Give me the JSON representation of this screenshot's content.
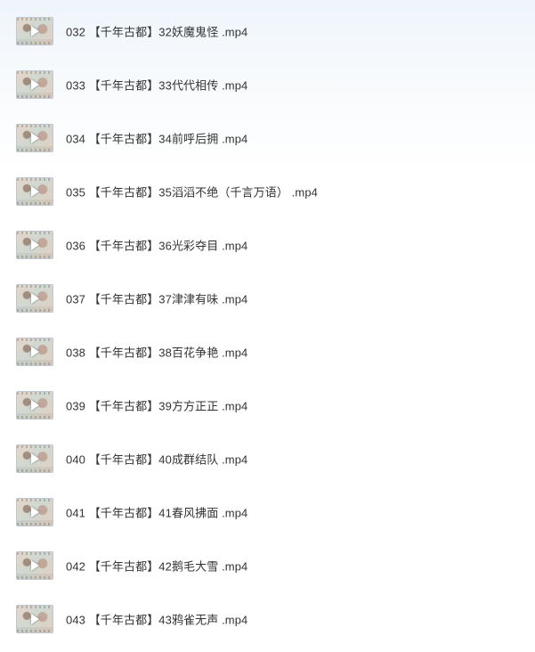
{
  "files": [
    {
      "name": "032 【千年古都】32妖魔鬼怪 .mp4",
      "icon": "video-thumbnail-icon"
    },
    {
      "name": "033 【千年古都】33代代相传 .mp4",
      "icon": "video-thumbnail-icon"
    },
    {
      "name": "034 【千年古都】34前呼后拥 .mp4",
      "icon": "video-thumbnail-icon"
    },
    {
      "name": "035 【千年古都】35滔滔不绝（千言万语） .mp4",
      "icon": "video-thumbnail-icon"
    },
    {
      "name": "036 【千年古都】36光彩夺目 .mp4",
      "icon": "video-thumbnail-icon"
    },
    {
      "name": "037 【千年古都】37津津有味 .mp4",
      "icon": "video-thumbnail-icon"
    },
    {
      "name": "038 【千年古都】38百花争艳 .mp4",
      "icon": "video-thumbnail-icon"
    },
    {
      "name": "039 【千年古都】39方方正正 .mp4",
      "icon": "video-thumbnail-icon"
    },
    {
      "name": "040 【千年古都】40成群结队 .mp4",
      "icon": "video-thumbnail-icon"
    },
    {
      "name": "041 【千年古都】41春风拂面 .mp4",
      "icon": "video-thumbnail-icon"
    },
    {
      "name": "042 【千年古都】42鹅毛大雪 .mp4",
      "icon": "video-thumbnail-icon"
    },
    {
      "name": "043 【千年古都】43鸦雀无声 .mp4",
      "icon": "video-thumbnail-icon"
    }
  ]
}
